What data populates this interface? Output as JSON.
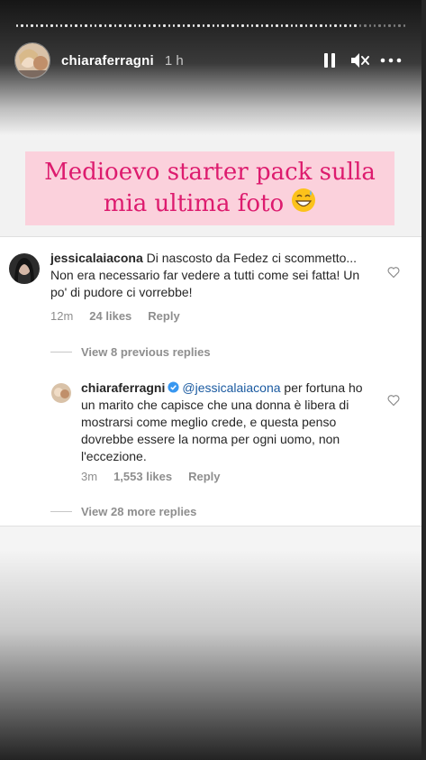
{
  "header": {
    "username": "chiaraferragni",
    "time_ago": "1 h",
    "pause_icon": "pause-icon",
    "mute_icon": "muted-speaker-icon",
    "more_icon": "more-horizontal-icon"
  },
  "banner": {
    "line1": "Medioevo starter pack sulla",
    "line2": "mia ultima foto",
    "emoji": "grinning-face-with-sweat-icon",
    "text_color": "#dd1b6e",
    "bg_color": "#fbd1dc"
  },
  "comments": {
    "first": {
      "username": "jessicalaiacona",
      "text": "Di nascosto da Fedez ci scommetto... Non era necessario far vedere a tutti come sei fatta! Un po' di pudore ci vorrebbe!",
      "time": "12m",
      "likes": "24 likes",
      "reply": "Reply"
    },
    "view_previous": "View 8 previous replies",
    "reply": {
      "username": "chiaraferragni",
      "mention": "@jessicalaiacona",
      "text": "per fortuna ho un marito che capisce che una donna è libera di mostrarsi come meglio crede, e questa penso dovrebbe essere la norma per ogni uomo, non l'eccezione.",
      "time": "3m",
      "likes": "1,553 likes",
      "reply": "Reply"
    },
    "view_more": "View 28 more replies"
  }
}
